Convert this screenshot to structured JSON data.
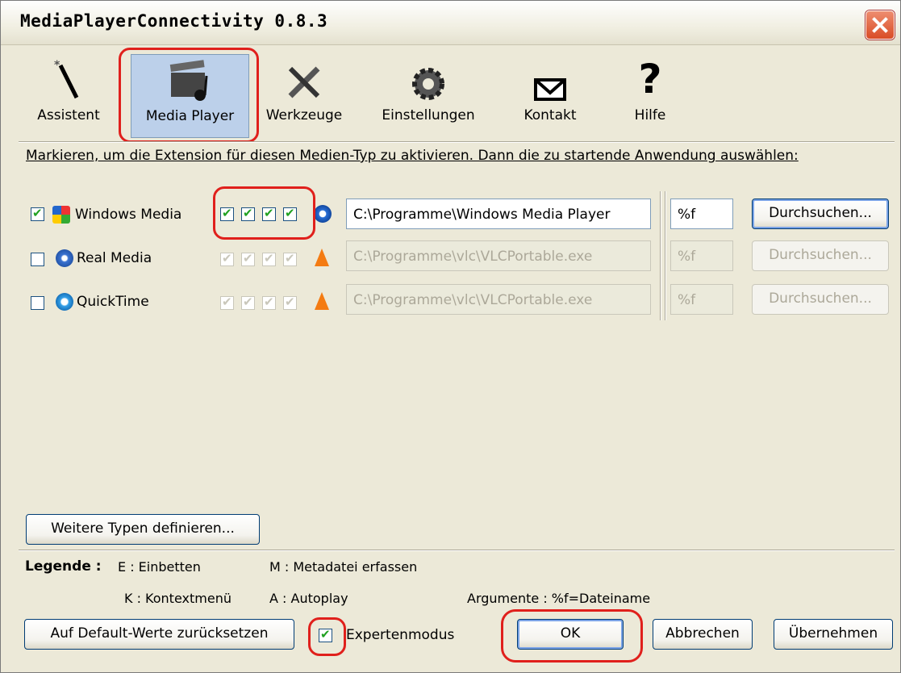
{
  "window": {
    "title": "MediaPlayerConnectivity 0.8.3"
  },
  "toolbar": [
    {
      "label": "Assistent",
      "icon": "wand-icon"
    },
    {
      "label": "Media Player",
      "icon": "clapperboard-icon"
    },
    {
      "label": "Werkzeuge",
      "icon": "tools-icon"
    },
    {
      "label": "Einstellungen",
      "icon": "gear-icon"
    },
    {
      "label": "Kontakt",
      "icon": "envelope-icon"
    },
    {
      "label": "Hilfe",
      "icon": "question-icon"
    }
  ],
  "hint_text": "Markieren, um die Extension für diesen Medien-Typ zu aktivieren. Dann die zu startende Anwendung auswählen:",
  "media_types": [
    {
      "name": "Windows Media",
      "enabled": true,
      "flags": [
        true,
        true,
        true,
        true
      ],
      "path": "C:\\Programme\\Windows Media Player",
      "args": "%f",
      "browse": "Durchsuchen..."
    },
    {
      "name": "Real Media",
      "enabled": false,
      "flags": [
        true,
        true,
        true,
        true
      ],
      "path": "C:\\Programme\\vlc\\VLCPortable.exe",
      "args": "%f",
      "browse": "Durchsuchen..."
    },
    {
      "name": "QuickTime",
      "enabled": false,
      "flags": [
        true,
        true,
        true,
        true
      ],
      "path": "C:\\Programme\\vlc\\VLCPortable.exe",
      "args": "%f",
      "browse": "Durchsuchen..."
    }
  ],
  "define_more_button": "Weitere Typen definieren...",
  "legend": {
    "title": "Legende :",
    "e": "E : Einbetten",
    "m": "M : Metadatei erfassen",
    "k": "K : Kontextmenü",
    "a": "A : Autoplay",
    "args": "Argumente : %f=Dateiname"
  },
  "footer": {
    "reset": "Auf Default-Werte zurücksetzen",
    "expert_label": "Expertenmodus",
    "expert_checked": true,
    "ok": "OK",
    "cancel": "Abbrechen",
    "apply": "Übernehmen"
  },
  "colors": {
    "highlight": "#e0201c",
    "check": "#21a121",
    "active_tool": "#bcd0ea"
  }
}
